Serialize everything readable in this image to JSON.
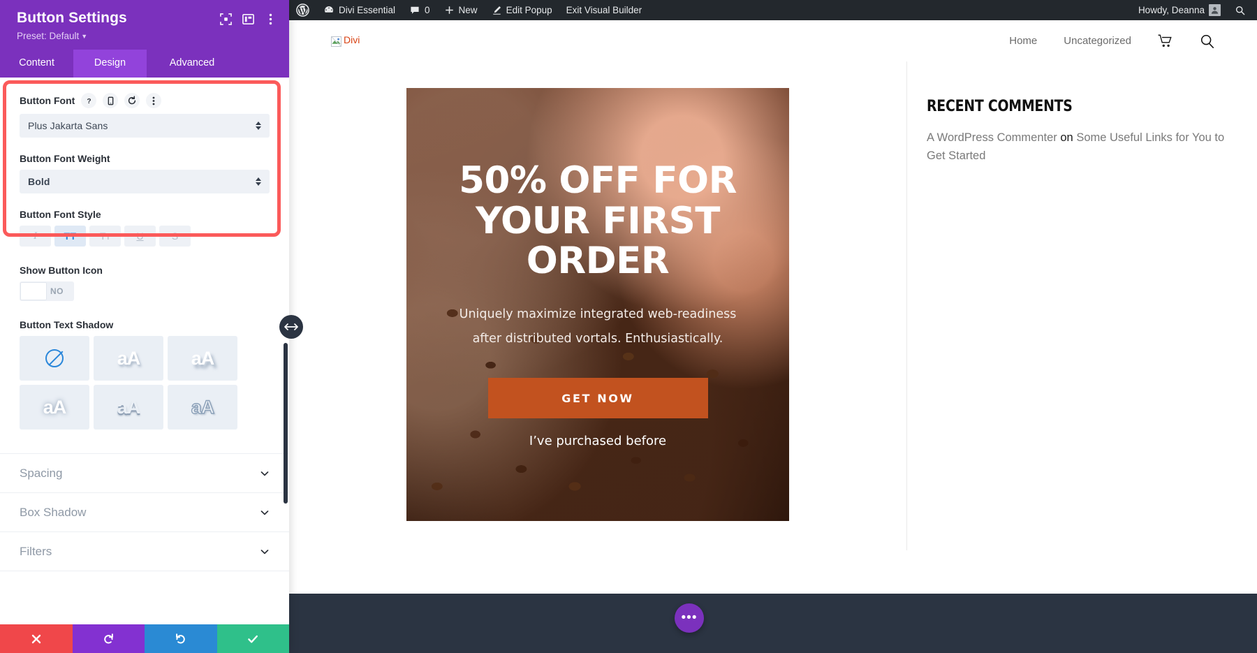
{
  "settings_panel": {
    "title": "Button Settings",
    "preset_label": "Preset: Default",
    "header_icons": [
      {
        "name": "focus-target-icon",
        "label": "focus"
      },
      {
        "name": "layout-columns-icon",
        "label": "layout"
      },
      {
        "name": "kebab-menu-icon",
        "label": "more"
      }
    ],
    "tabs": [
      {
        "label": "Content",
        "active": false
      },
      {
        "label": "Design",
        "active": true
      },
      {
        "label": "Advanced",
        "active": false
      }
    ],
    "fields": {
      "button_font": {
        "label": "Button Font",
        "value": "Plus Jakarta Sans",
        "icons": [
          "help-icon",
          "mobile-icon",
          "reset-icon",
          "kebab-menu-icon"
        ]
      },
      "button_font_weight": {
        "label": "Button Font Weight",
        "value": "Bold"
      },
      "button_font_style": {
        "label": "Button Font Style",
        "options": [
          {
            "name": "italic",
            "glyph": "I",
            "active": false
          },
          {
            "name": "uppercase",
            "glyph": "TT",
            "active": true
          },
          {
            "name": "small-caps",
            "glyph": "Tт",
            "active": false
          },
          {
            "name": "underline",
            "glyph": "U",
            "active": false
          },
          {
            "name": "strikethrough",
            "glyph": "S",
            "active": false
          }
        ]
      },
      "show_button_icon": {
        "label": "Show Button Icon",
        "toggle_value": "NO"
      },
      "button_text_shadow": {
        "label": "Button Text Shadow",
        "presets": [
          {
            "name": "none",
            "glyph": ""
          },
          {
            "name": "shadow-1",
            "glyph": "aA"
          },
          {
            "name": "shadow-2",
            "glyph": "aA"
          },
          {
            "name": "shadow-3",
            "glyph": "aA"
          },
          {
            "name": "shadow-4",
            "glyph": "aA"
          },
          {
            "name": "shadow-5",
            "glyph": "aA"
          }
        ]
      }
    },
    "accordions": [
      {
        "label": "Spacing"
      },
      {
        "label": "Box Shadow"
      },
      {
        "label": "Filters"
      }
    ],
    "footer_buttons": [
      {
        "name": "cancel",
        "glyph": "✖",
        "color": "#f0474a"
      },
      {
        "name": "undo",
        "glyph": "↺",
        "color": "#8331d1"
      },
      {
        "name": "redo",
        "glyph": "↻",
        "color": "#2a8ad4"
      },
      {
        "name": "save",
        "glyph": "✔",
        "color": "#2fc08a"
      }
    ],
    "highlight_color": "#fb5a5a",
    "accent_color": "#7b31bd"
  },
  "admin_bar": {
    "items": [
      {
        "name": "wp-logo",
        "label": ""
      },
      {
        "name": "site-name",
        "label": "Divi Essential"
      },
      {
        "name": "comments",
        "label": "0"
      },
      {
        "name": "new-content",
        "label": "New"
      },
      {
        "name": "edit-popup",
        "label": "Edit Popup"
      },
      {
        "name": "exit-visual-builder",
        "label": "Exit Visual Builder"
      }
    ],
    "howdy": "Howdy, Deanna",
    "search_label": "Search"
  },
  "site": {
    "logo": {
      "alt_text": "Divi",
      "broken": true
    },
    "nav": [
      {
        "label": "Home"
      },
      {
        "label": "Uncategorized"
      }
    ],
    "nav_icons": [
      {
        "name": "cart-icon"
      },
      {
        "name": "search-icon"
      }
    ],
    "popup": {
      "heading": "50% OFF FOR YOUR FIRST ORDER",
      "subtext": "Uniquely maximize integrated web-readiness after distributed vortals. Enthusiastically.",
      "cta_label": "GET NOW",
      "secondary_link": "I’ve purchased before",
      "cta_color": "#c2521f"
    },
    "sidebar": {
      "widget_title": "Recent Comments",
      "comment": {
        "author": "A WordPress Commenter",
        "on": "on",
        "post_title": "Some Useful Links for You to Get Started"
      }
    }
  },
  "visual_builder": {
    "fab_label": "•••",
    "drag_handle": "↔"
  }
}
